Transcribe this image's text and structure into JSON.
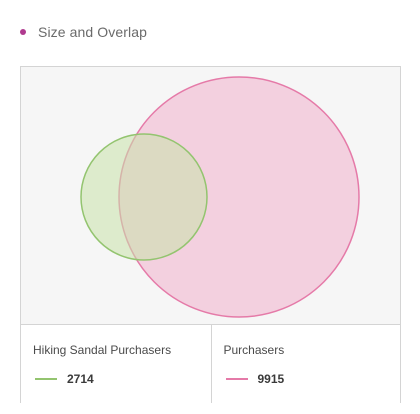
{
  "header": {
    "title": "Size and Overlap",
    "dot_color": "#b03a8f"
  },
  "venn": {
    "sets": [
      {
        "label": "Hiking Sandal Purchasers",
        "value": "2714",
        "stroke": "#93c46f",
        "fill": "rgba(200, 225, 170, 0.55)"
      },
      {
        "label": "Purchasers",
        "value": "9915",
        "stroke": "#e57aa8",
        "fill": "rgba(240, 170, 200, 0.50)"
      }
    ]
  }
}
